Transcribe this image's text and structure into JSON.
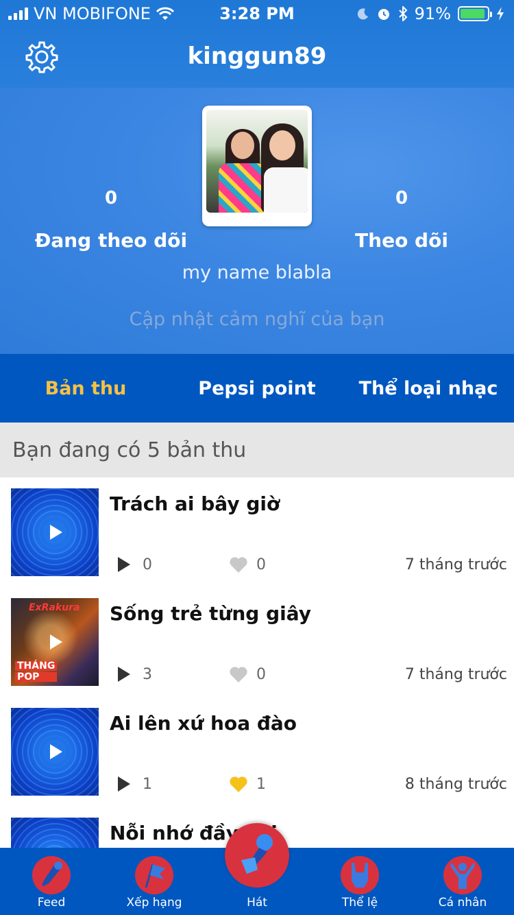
{
  "status_bar": {
    "carrier": "VN MOBIFONE",
    "time": "3:28 PM",
    "battery": "91%",
    "battery_level": 0.91
  },
  "nav": {
    "title": "kinggun89",
    "settings_icon": "gear-icon"
  },
  "profile": {
    "following_count": "0",
    "following_label": "Đang theo dõi",
    "followers_count": "0",
    "followers_label": "Theo dõi",
    "display_name": "my name blabla",
    "status_placeholder": "Cập nhật cảm nghĩ của bạn"
  },
  "tabs": [
    {
      "label": "Bản thu",
      "active": true
    },
    {
      "label": "Pepsi point",
      "active": false
    },
    {
      "label": "Thể loại nhạc",
      "active": false
    }
  ],
  "records_banner": "Bạn đang có 5 bản thu",
  "records": [
    {
      "title": "Trách ai bây giờ",
      "plays": "0",
      "likes": "0",
      "liked": false,
      "ago": "7 tháng trước",
      "thumb": "blue"
    },
    {
      "title": "Sống trẻ từng giây",
      "plays": "3",
      "likes": "0",
      "liked": false,
      "ago": "7 tháng trước",
      "thumb": "album",
      "album_text_top": "ExRakura",
      "album_text_bottom": [
        "THÁNG",
        "POP"
      ]
    },
    {
      "title": "Ai lên xứ hoa đào",
      "plays": "1",
      "likes": "1",
      "liked": true,
      "ago": "8 tháng trước",
      "thumb": "blue"
    },
    {
      "title": "Nỗi nhớ đầy vơi",
      "plays": "",
      "likes": "",
      "liked": false,
      "ago": "",
      "thumb": "blue"
    }
  ],
  "tabbar": [
    {
      "label": "Feed",
      "icon": "microphone-icon"
    },
    {
      "label": "Xếp hạng",
      "icon": "flag-icon"
    },
    {
      "label": "Hát",
      "icon": "microphone-hand-icon"
    },
    {
      "label": "Thể lệ",
      "icon": "rock-hand-icon"
    },
    {
      "label": "Cá nhân",
      "icon": "person-cheer-icon"
    }
  ],
  "colors": {
    "primary_blue": "#0057c0",
    "active_tab": "#f5c243",
    "liked_heart": "#f5c21b",
    "tab_icon_bg": "#d9323f"
  }
}
